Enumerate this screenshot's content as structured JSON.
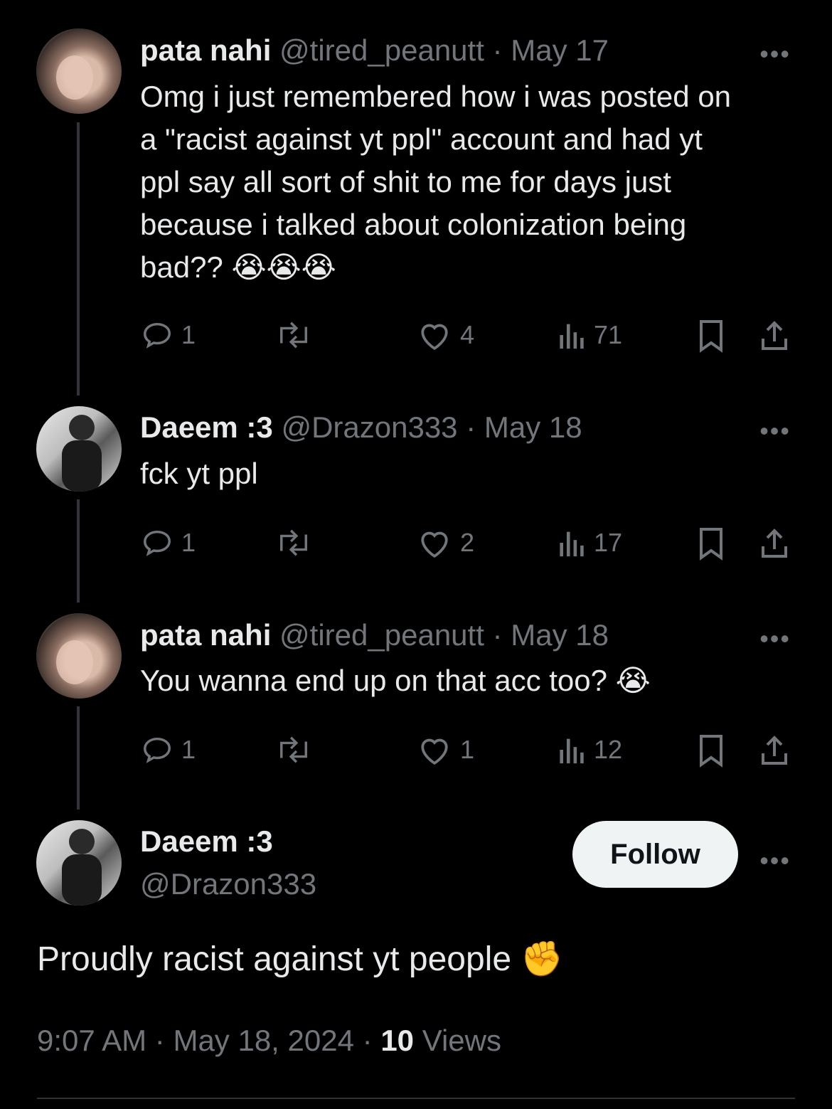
{
  "replies": [
    {
      "name": "pata nahi",
      "handle": "@tired_peanutt",
      "date": "May 17",
      "text_lines": [
        "Omg i just remembered how i was posted on",
        "a \"racist against yt ppl\" account and had yt",
        "ppl say all sort of shit to me for days just",
        "because i talked about colonization being"
      ],
      "last_line": "bad??",
      "emoji": "😭😭😭",
      "replies": "1",
      "likes": "4",
      "views": "71"
    },
    {
      "name": "Daeem :3",
      "handle": "@Drazon333",
      "date": "May 18",
      "text": "fck yt ppl",
      "replies": "1",
      "likes": "2",
      "views": "17"
    },
    {
      "name": "pata nahi",
      "handle": "@tired_peanutt",
      "date": "May 18",
      "text": "You wanna end up on that acc too?",
      "emoji": "😭",
      "replies": "1",
      "likes": "1",
      "views": "12"
    }
  ],
  "main": {
    "name": "Daeem :3",
    "handle": "@Drazon333",
    "follow_label": "Follow",
    "text": "Proudly racist against yt people",
    "emoji": "✊",
    "time": "9:07 AM",
    "date": "May 18, 2024",
    "views_count": "10",
    "views_label": "Views"
  },
  "separator": "·",
  "more_glyph": "•••"
}
